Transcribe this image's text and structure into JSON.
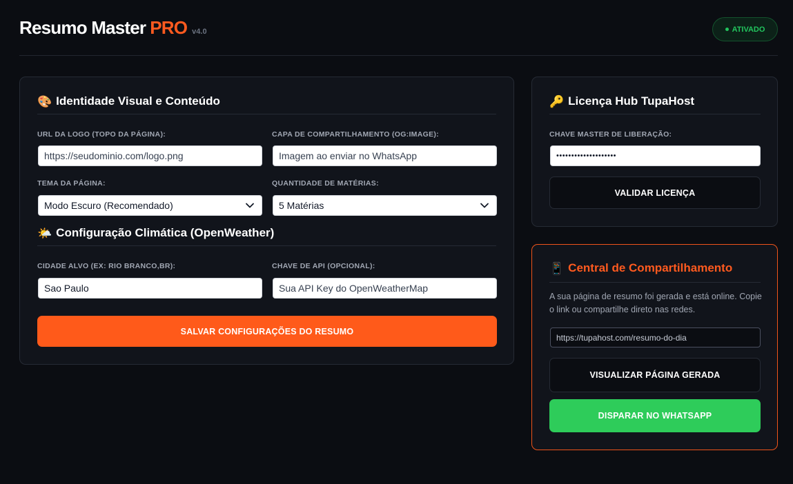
{
  "header": {
    "brand_name": "Resumo Master",
    "brand_pro": "PRO",
    "version": "v4.0",
    "status": "ATIVADO"
  },
  "identity": {
    "title": "Identidade Visual e Conteúdo",
    "title_icon": "palette-icon",
    "logo_url_label": "URL DA LOGO (TOPO DA PÁGINA):",
    "logo_url_placeholder": "https://seudominio.com/logo.png",
    "share_cover_label": "CAPA DE COMPARTILHAMENTO (OG:IMAGE):",
    "share_cover_placeholder": "Imagem ao enviar no WhatsApp",
    "theme_label": "TEMA DA PÁGINA:",
    "theme_value": "Modo Escuro (Recomendado)",
    "count_label": "QUANTIDADE DE MATÉRIAS:",
    "count_value": "5 Matérias"
  },
  "weather": {
    "title": "Configuração Climática (OpenWeather)",
    "title_icon": "sun-cloud-icon",
    "city_label": "CIDADE ALVO (EX: RIO BRANCO,BR):",
    "city_value": "Sao Paulo",
    "api_label": "CHAVE DE API (OPCIONAL):",
    "api_placeholder": "Sua API Key do OpenWeatherMap"
  },
  "save_button": "SALVAR CONFIGURAÇÕES DO RESUMO",
  "license": {
    "title": "Licença Hub TupaHost",
    "title_icon": "key-icon",
    "key_label": "CHAVE MASTER DE LIBERAÇÃO:",
    "key_value": "••••••••••••••••••••",
    "validate_button": "VALIDAR LICENÇA"
  },
  "share": {
    "title": "Central de Compartilhamento",
    "title_icon": "phone-icon",
    "description": "A sua página de resumo foi gerada e está online. Copie o link ou compartilhe direto nas redes.",
    "link_placeholder": "https://tupahost.com/resumo-do-dia",
    "view_button": "VISUALIZAR PÁGINA GERADA",
    "whatsapp_button": "DISPARAR NO WHATSAPP"
  },
  "colors": {
    "accent": "#ff5a1f",
    "success": "#22c55e",
    "whatsapp": "#2ecc5a",
    "background": "#0b0d12",
    "card": "#11141b"
  }
}
